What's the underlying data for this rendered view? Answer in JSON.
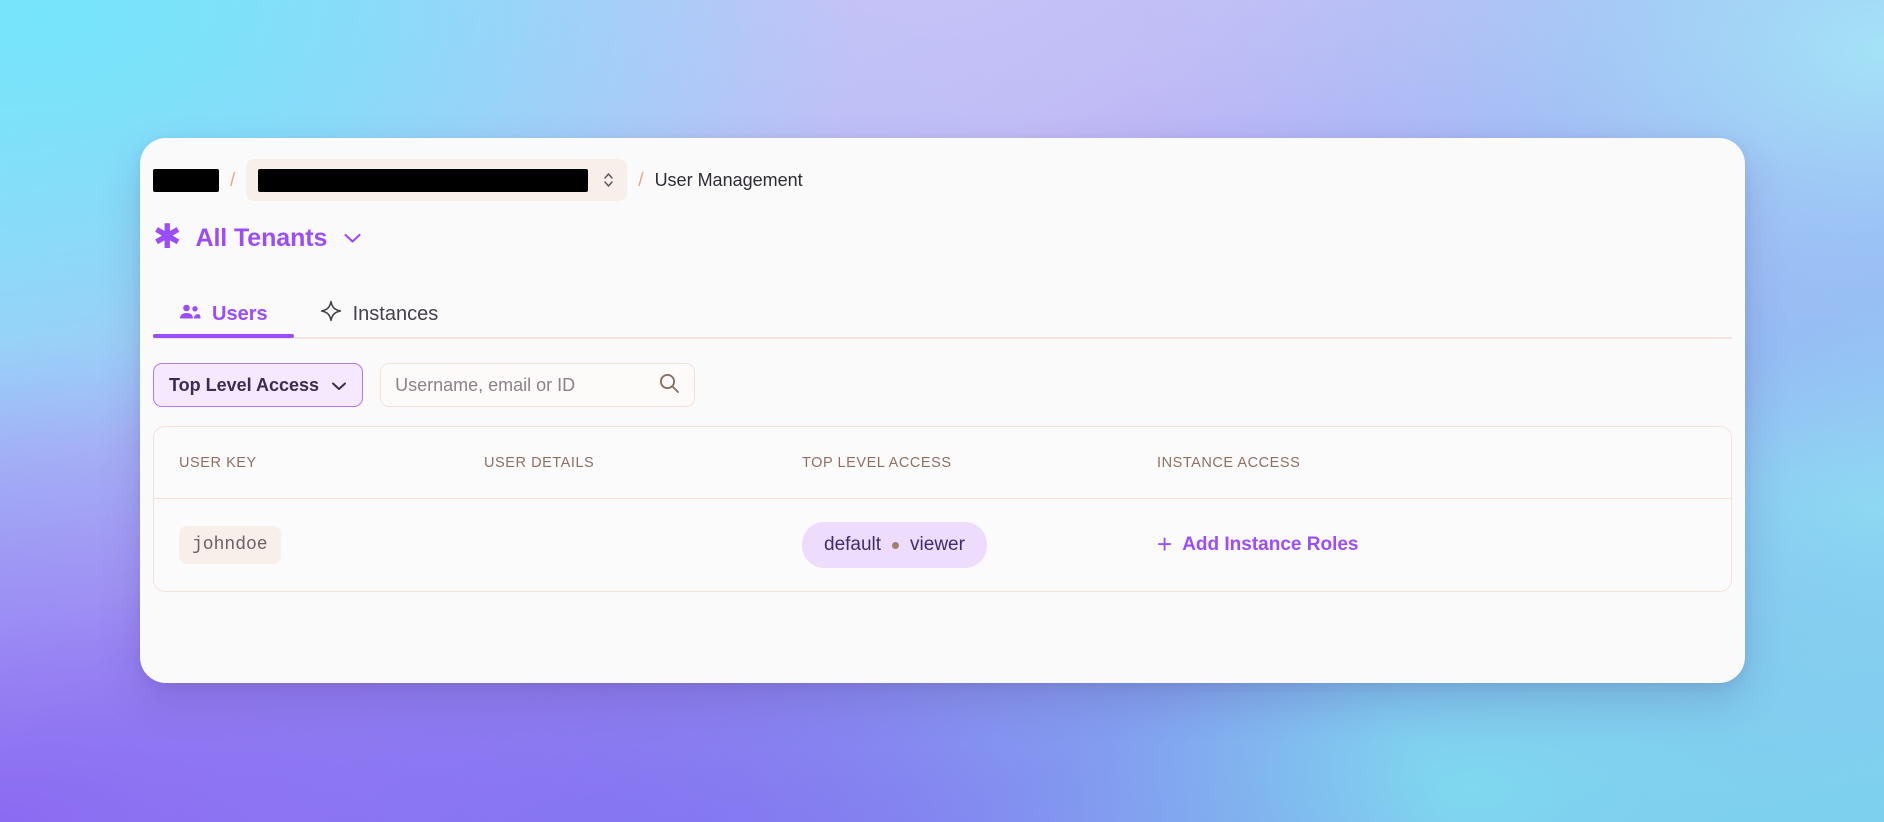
{
  "breadcrumb": {
    "org_redacted": "",
    "project_redacted": "",
    "separator": "/",
    "current": "User Management",
    "selector_icon": "chevron-up-down-icon"
  },
  "tenant_header": {
    "icon": "asterisk-icon",
    "label": "All Tenants",
    "chevron": "chevron-down-icon"
  },
  "tabs": [
    {
      "id": "users",
      "label": "Users",
      "icon": "people-icon",
      "active": true
    },
    {
      "id": "instances",
      "label": "Instances",
      "icon": "sparkle-icon",
      "active": false
    }
  ],
  "filters": {
    "dropdown_label": "Top Level Access",
    "dropdown_chevron": "chevron-down-icon",
    "search_placeholder": "Username, email or ID",
    "search_value": "",
    "search_icon": "search-icon"
  },
  "table": {
    "columns": [
      "USER KEY",
      "USER DETAILS",
      "TOP LEVEL ACCESS",
      "INSTANCE ACCESS"
    ],
    "rows": [
      {
        "user_key": "johndoe",
        "user_details": "",
        "top_level_access": {
          "scope": "default",
          "role": "viewer",
          "separator": "dot"
        },
        "instance_access": {
          "plus": "+",
          "label": "Add Instance Roles"
        }
      }
    ]
  },
  "colors": {
    "accent_purple": "#9b4dfc",
    "badge_bg": "#eddcfc",
    "pill_bg": "#f7efe9",
    "header_text": "#8f6f62",
    "border": "#f3e2db",
    "card_bg": "#fbfafa"
  }
}
